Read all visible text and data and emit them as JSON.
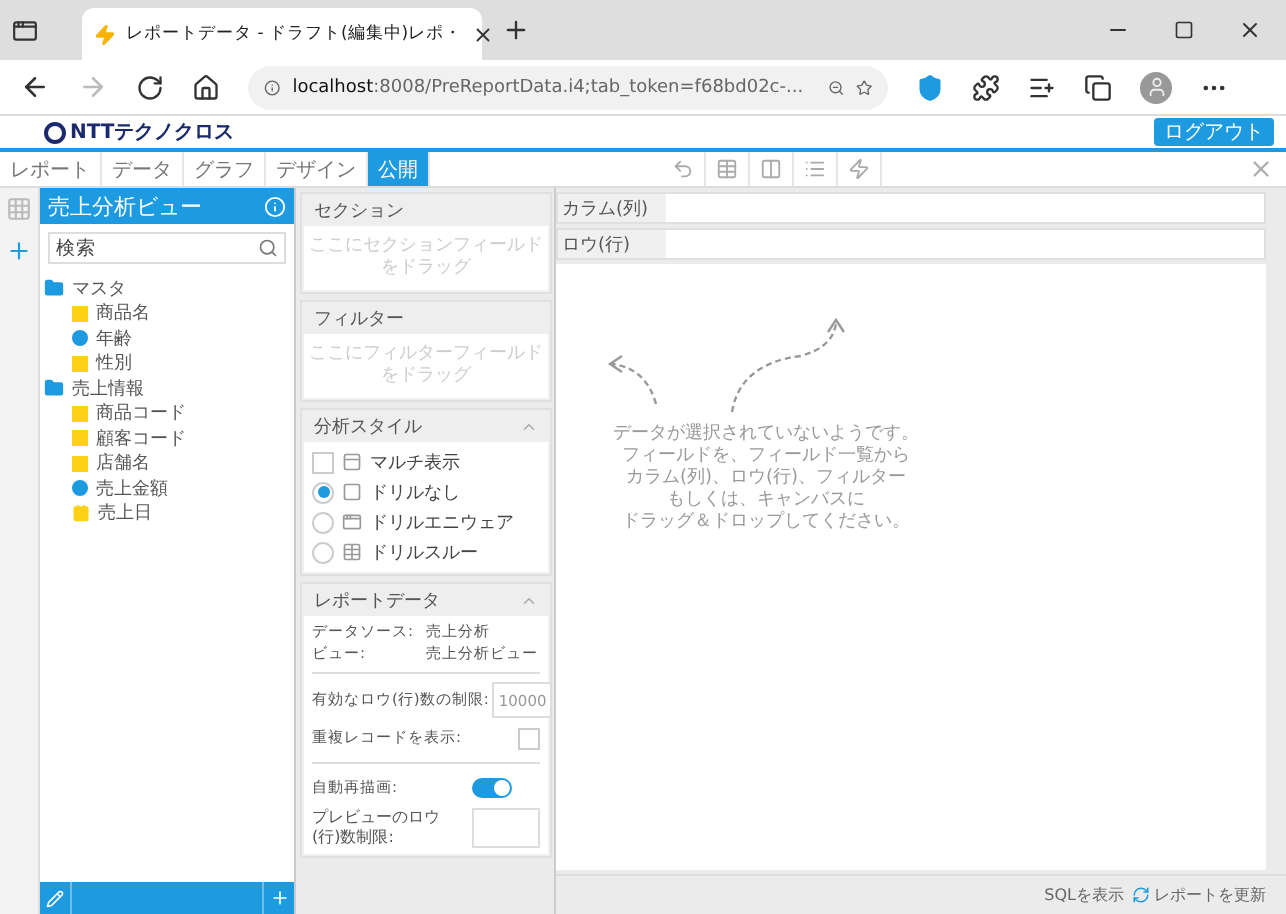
{
  "browser": {
    "tab_title": "レポートデータ - ドラフト(編集中)レポ・",
    "url_host": "localhost",
    "url_rest": ":8008/PreReportData.i4;tab_token=f68bd02c-..."
  },
  "header": {
    "logo": "NTTテクノクロス",
    "logout": "ログアウト"
  },
  "nav_tabs": [
    {
      "label": "レポート",
      "selected": false
    },
    {
      "label": "データ",
      "selected": false
    },
    {
      "label": "グラフ",
      "selected": false
    },
    {
      "label": "デザイン",
      "selected": false
    },
    {
      "label": "公開",
      "selected": true
    }
  ],
  "field_panel": {
    "title": "売上分析ビュー",
    "search": {
      "placeholder": "検索"
    },
    "folders": [
      {
        "label": "マスタ",
        "children": [
          {
            "label": "商品名",
            "kind": "dimension"
          },
          {
            "label": "年齢",
            "kind": "measure"
          },
          {
            "label": "性別",
            "kind": "dimension"
          }
        ]
      },
      {
        "label": "売上情報",
        "children": [
          {
            "label": "商品コード",
            "kind": "dimension"
          },
          {
            "label": "顧客コード",
            "kind": "dimension"
          },
          {
            "label": "店舗名",
            "kind": "dimension"
          },
          {
            "label": "売上金額",
            "kind": "measure"
          },
          {
            "label": "売上日",
            "kind": "date"
          }
        ]
      }
    ]
  },
  "section": {
    "title": "セクション",
    "placeholder": "ここにセクションフィールドをドラッグ"
  },
  "filter": {
    "title": "フィルター",
    "placeholder": "ここにフィルターフィールドをドラッグ"
  },
  "analysis_style": {
    "title": "分析スタイル",
    "expanded": true,
    "options": [
      {
        "label": "マルチ表示",
        "kind": "checkbox",
        "selected": false
      },
      {
        "label": "ドリルなし",
        "kind": "radio",
        "selected": true
      },
      {
        "label": "ドリルエニウェア",
        "kind": "radio",
        "selected": false
      },
      {
        "label": "ドリルスルー",
        "kind": "radio",
        "selected": false
      }
    ]
  },
  "report_data": {
    "title": "レポートデータ",
    "expanded": true,
    "info": [
      {
        "label": "データソース:",
        "value": "売上分析"
      },
      {
        "label": "ビュー:",
        "value": "売上分析ビュー"
      }
    ],
    "row_limit": {
      "label": "有効なロウ(行)数の制限:",
      "placeholder": "10000"
    },
    "duplicates": {
      "label": "重複レコードを表示:",
      "checked": false
    },
    "auto_redraw": {
      "label": "自動再描画:",
      "on": true
    },
    "preview_limit": {
      "label": "プレビューのロウ(行)数制限:"
    }
  },
  "canvas": {
    "column_label": "カラム(列)",
    "row_label": "ロウ(行)",
    "message_lines": [
      "データが選択されていないようです。",
      "フィールドを、フィールド一覧から",
      "カラム(列)、ロウ(行)、フィルター",
      "もしくは、キャンバスに",
      "ドラッグ＆ドロップしてください。"
    ]
  },
  "footer": {
    "show_sql": "SQLを表示",
    "refresh": "レポートを更新"
  }
}
